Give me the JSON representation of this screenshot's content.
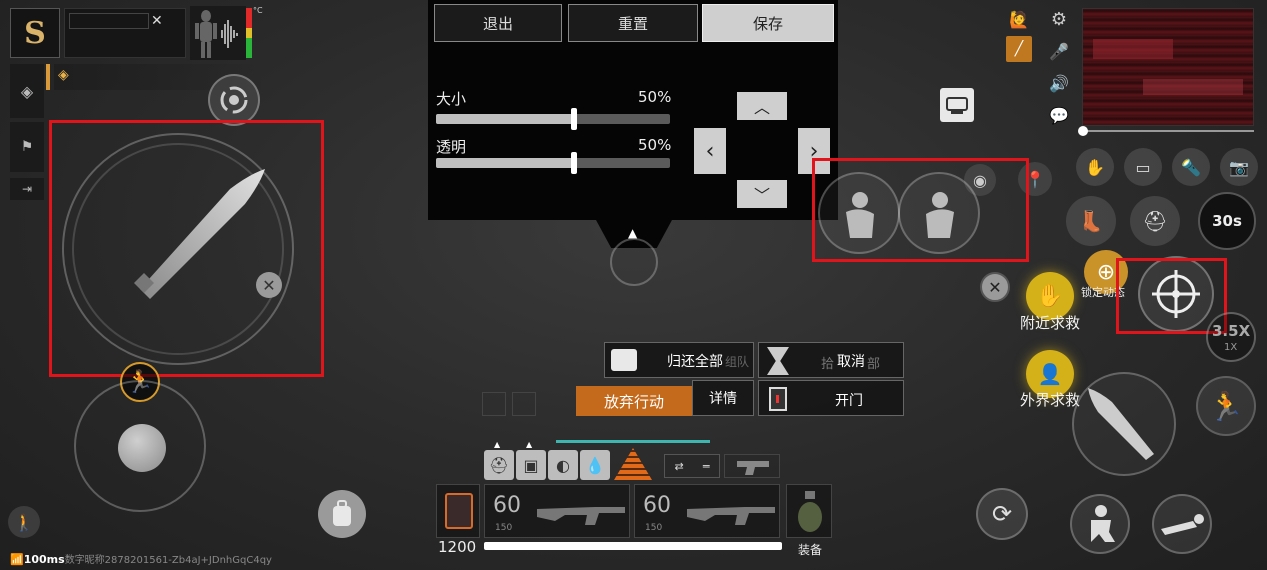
{
  "top_panel": {
    "tabs": [
      "退出",
      "重置",
      "保存"
    ],
    "size_label": "大小",
    "size_value": "50%",
    "size_level": 0.5,
    "opacity_label": "透明",
    "opacity_value": "50%",
    "opacity_level": 0.5
  },
  "top_left": {
    "logo_text": "S",
    "temperature_unit": "°C",
    "close_glyph": "✕"
  },
  "right_labels": {
    "lock_dynamic": "锁定动态",
    "nearby_rescue": "附近求救",
    "outside_rescue": "外界求救",
    "timer": "30s",
    "zoom": "3.5X",
    "zoom_sub": "1X"
  },
  "action_panel": {
    "return_all": "归还全部",
    "return_all_ghost": "组队",
    "cancel": "取消",
    "cancel_ghost_left": "拾",
    "cancel_ghost_right": "部",
    "abandon": "放弃行动",
    "details": "详情",
    "open_door": "开门"
  },
  "weapons": {
    "primary_ammo": "60",
    "primary_reserve": "150",
    "secondary_ammo": "60",
    "secondary_reserve": "150",
    "equip_label": "装备",
    "money": "1200"
  },
  "status_bar": {
    "ping": "100ms",
    "player_info": "数字昵称2878201561-Zb4aJ+JDnhGqC4qy"
  },
  "colors": {
    "red_highlight": "#e0141a",
    "accent_orange": "#c46a1d",
    "yellow_icon": "#d4b019",
    "teal_bar": "#3fb5b0"
  }
}
